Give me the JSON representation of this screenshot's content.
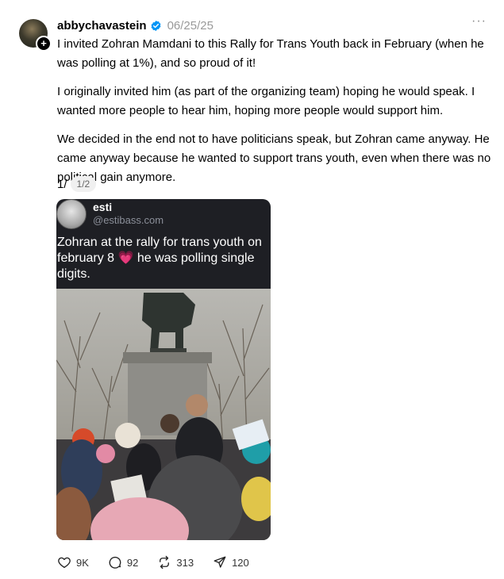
{
  "post": {
    "username": "abbychavastein",
    "timestamp": "06/25/25",
    "more_label": "···",
    "paragraphs": [
      "I invited Zohran Mamdani to this Rally for Trans Youth back in February (when he was polling at 1%), and so proud of it!",
      "I originally invited him (as part of the organizing team) hoping he would speak. I wanted more people to hear him, hoping more people would support him.",
      "We decided in the end not to have politicians speak, but Zohran came anyway. He came anyway because he wanted to support trans youth, even when there was no political gain anymore."
    ],
    "counter_prefix": "1/",
    "counter_badge": "1/2"
  },
  "embedded": {
    "name": "esti",
    "handle": "@estibass.com",
    "text": "Zohran at the rally for trans youth on february 8 💗 he was polling single digits."
  },
  "actions": {
    "likes": "9K",
    "replies": "92",
    "reposts": "313",
    "shares": "120"
  },
  "icons": [
    "verified-badge-icon",
    "more-icon",
    "heart-icon",
    "comment-icon",
    "repost-icon",
    "share-icon"
  ],
  "colors": {
    "verified": "#0095f6",
    "muted": "#999999",
    "card_bg": "#1e1f24"
  }
}
